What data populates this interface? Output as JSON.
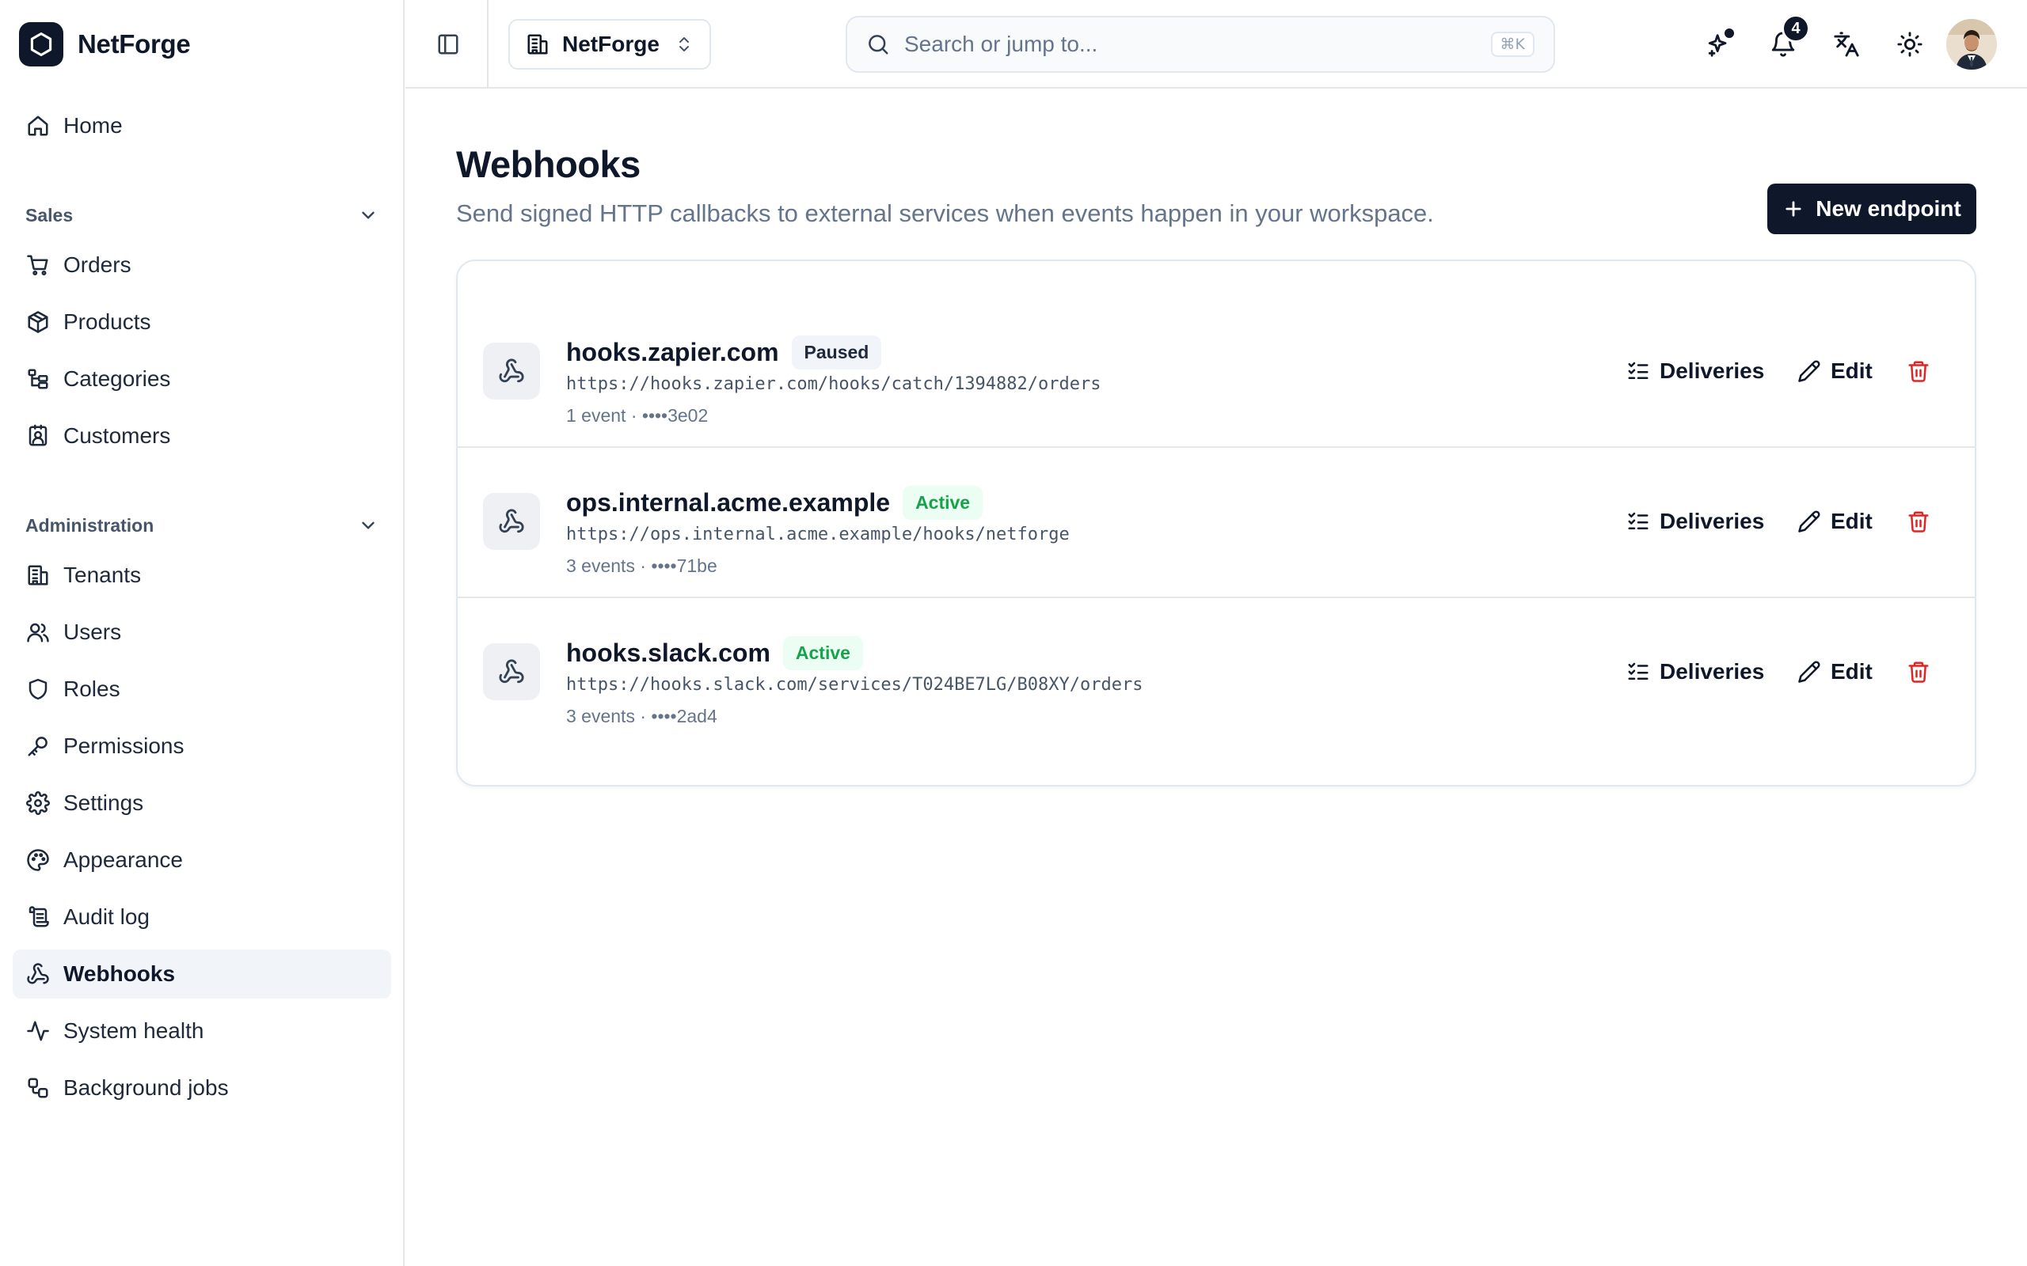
{
  "brand": {
    "name": "NetForge"
  },
  "sidebar": {
    "home": {
      "label": "Home",
      "icon": "home-icon"
    },
    "groups": [
      {
        "label": "Sales",
        "items": [
          {
            "label": "Orders",
            "icon": "cart-icon"
          },
          {
            "label": "Products",
            "icon": "package-icon"
          },
          {
            "label": "Categories",
            "icon": "tree-icon"
          },
          {
            "label": "Customers",
            "icon": "contact-icon"
          }
        ]
      },
      {
        "label": "Administration",
        "items": [
          {
            "label": "Tenants",
            "icon": "building-icon"
          },
          {
            "label": "Users",
            "icon": "users-icon"
          },
          {
            "label": "Roles",
            "icon": "shield-icon"
          },
          {
            "label": "Permissions",
            "icon": "key-icon"
          },
          {
            "label": "Settings",
            "icon": "gear-icon"
          },
          {
            "label": "Appearance",
            "icon": "palette-icon"
          },
          {
            "label": "Audit log",
            "icon": "scroll-icon"
          },
          {
            "label": "Webhooks",
            "icon": "webhook-icon",
            "active": true
          },
          {
            "label": "System health",
            "icon": "activity-icon"
          },
          {
            "label": "Background jobs",
            "icon": "workflow-icon"
          }
        ]
      }
    ]
  },
  "topbar": {
    "tenant": "NetForge",
    "search_placeholder": "Search or jump to...",
    "search_shortcut": "⌘K",
    "notification_count": "4"
  },
  "page": {
    "title": "Webhooks",
    "subtitle": "Send signed HTTP callbacks to external services when events happen in your workspace.",
    "new_button": "New endpoint"
  },
  "endpoints": [
    {
      "host": "hooks.zapier.com",
      "status": "Paused",
      "url": "https://hooks.zapier.com/hooks/catch/1394882/orders",
      "meta": "1 event · ••••3e02",
      "deliveries_label": "Deliveries",
      "edit_label": "Edit"
    },
    {
      "host": "ops.internal.acme.example",
      "status": "Active",
      "url": "https://ops.internal.acme.example/hooks/netforge",
      "meta": "3 events · ••••71be",
      "deliveries_label": "Deliveries",
      "edit_label": "Edit"
    },
    {
      "host": "hooks.slack.com",
      "status": "Active",
      "url": "https://hooks.slack.com/services/T024BE7LG/B08XY/orders",
      "meta": "3 events · ••••2ad4",
      "deliveries_label": "Deliveries",
      "edit_label": "Edit"
    }
  ],
  "colors": {
    "primary": "#0f172a",
    "active_status": "#16a34a",
    "danger": "#dc2626",
    "muted": "#64748b"
  }
}
